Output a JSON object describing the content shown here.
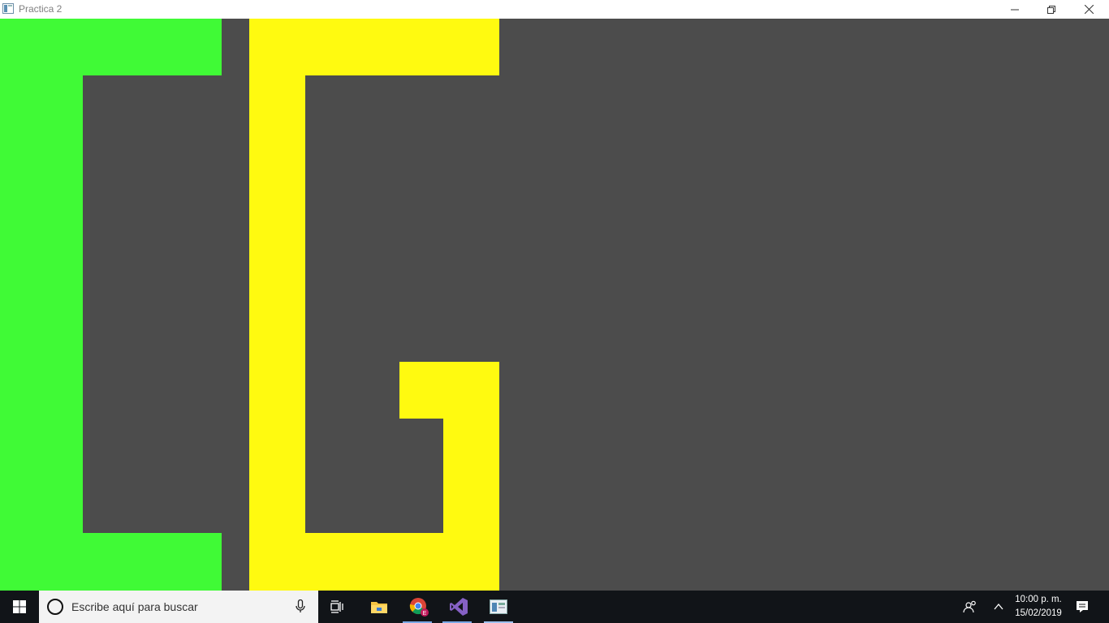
{
  "window": {
    "title": "Practica 2",
    "icon": "app-window-icon",
    "controls": [
      "minimize-icon",
      "restore-icon",
      "close-icon"
    ]
  },
  "canvas": {
    "background": "#4c4c4c",
    "shapes": [
      {
        "letter": "C",
        "color": "#40fa36"
      },
      {
        "letter": "G",
        "color": "#fffa10"
      }
    ]
  },
  "taskbar": {
    "search_placeholder": "Escribe aquí para buscar",
    "apps": [
      "task-view-icon",
      "file-explorer-icon",
      "chrome-icon",
      "visual-studio-icon",
      "app-window-icon"
    ],
    "tray_icons": [
      "people-icon",
      "chevron-up-icon",
      "notification-icon"
    ],
    "clock": {
      "time": "10:00 p. m.",
      "date": "15/02/2019"
    }
  }
}
